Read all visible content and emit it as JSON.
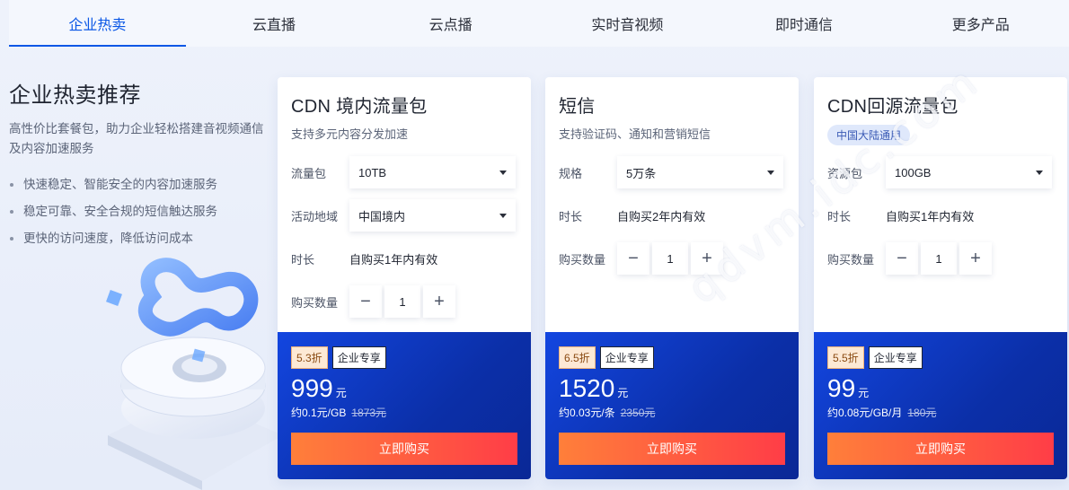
{
  "tabs": [
    {
      "label": "企业热卖",
      "active": true
    },
    {
      "label": "云直播",
      "active": false
    },
    {
      "label": "云点播",
      "active": false
    },
    {
      "label": "实时音视频",
      "active": false
    },
    {
      "label": "即时通信",
      "active": false
    },
    {
      "label": "更多产品",
      "active": false
    }
  ],
  "intro": {
    "title": "企业热卖推荐",
    "desc": "高性价比套餐包，助力企业轻松搭建音视频通信及内容加速服务",
    "features": [
      "快速稳定、智能安全的内容加速服务",
      "稳定可靠、安全合规的短信触达服务",
      "更快的访问速度，降低访问成本"
    ]
  },
  "cards": [
    {
      "title": "CDN 境内流量包",
      "subtitle": "支持多元内容分发加速",
      "rows": {
        "pkg_label": "流量包",
        "pkg_value": "10TB",
        "region_label": "活动地域",
        "region_value": "中国境内",
        "duration_label": "时长",
        "duration_value": "自购买1年内有效",
        "qty_label": "购买数量",
        "qty_value": "1"
      },
      "discount": "5.3折",
      "enterprise": "企业专享",
      "price": "999",
      "price_unit": "元",
      "unit_price": "约0.1元/GB",
      "orig_price": "1873元",
      "buy": "立即购买"
    },
    {
      "title": "短信",
      "subtitle": "支持验证码、通知和营销短信",
      "rows": {
        "spec_label": "规格",
        "spec_value": "5万条",
        "duration_label": "时长",
        "duration_value": "自购买2年内有效",
        "qty_label": "购买数量",
        "qty_value": "1"
      },
      "discount": "6.5折",
      "enterprise": "企业专享",
      "price": "1520",
      "price_unit": "元",
      "unit_price": "约0.03元/条",
      "orig_price": "2350元",
      "buy": "立即购买"
    },
    {
      "title": "CDN回源流量包",
      "tag": "中国大陆通用",
      "rows": {
        "pkg_label": "资源包",
        "pkg_value": "100GB",
        "duration_label": "时长",
        "duration_value": "自购买1年内有效",
        "qty_label": "购买数量",
        "qty_value": "1"
      },
      "discount": "5.5折",
      "enterprise": "企业专享",
      "price": "99",
      "price_unit": "元",
      "unit_price": "约0.08元/GB/月",
      "orig_price": "180元",
      "buy": "立即购买"
    }
  ],
  "watermark": "qdvm.idc.com",
  "step_minus": "−",
  "step_plus": "+"
}
